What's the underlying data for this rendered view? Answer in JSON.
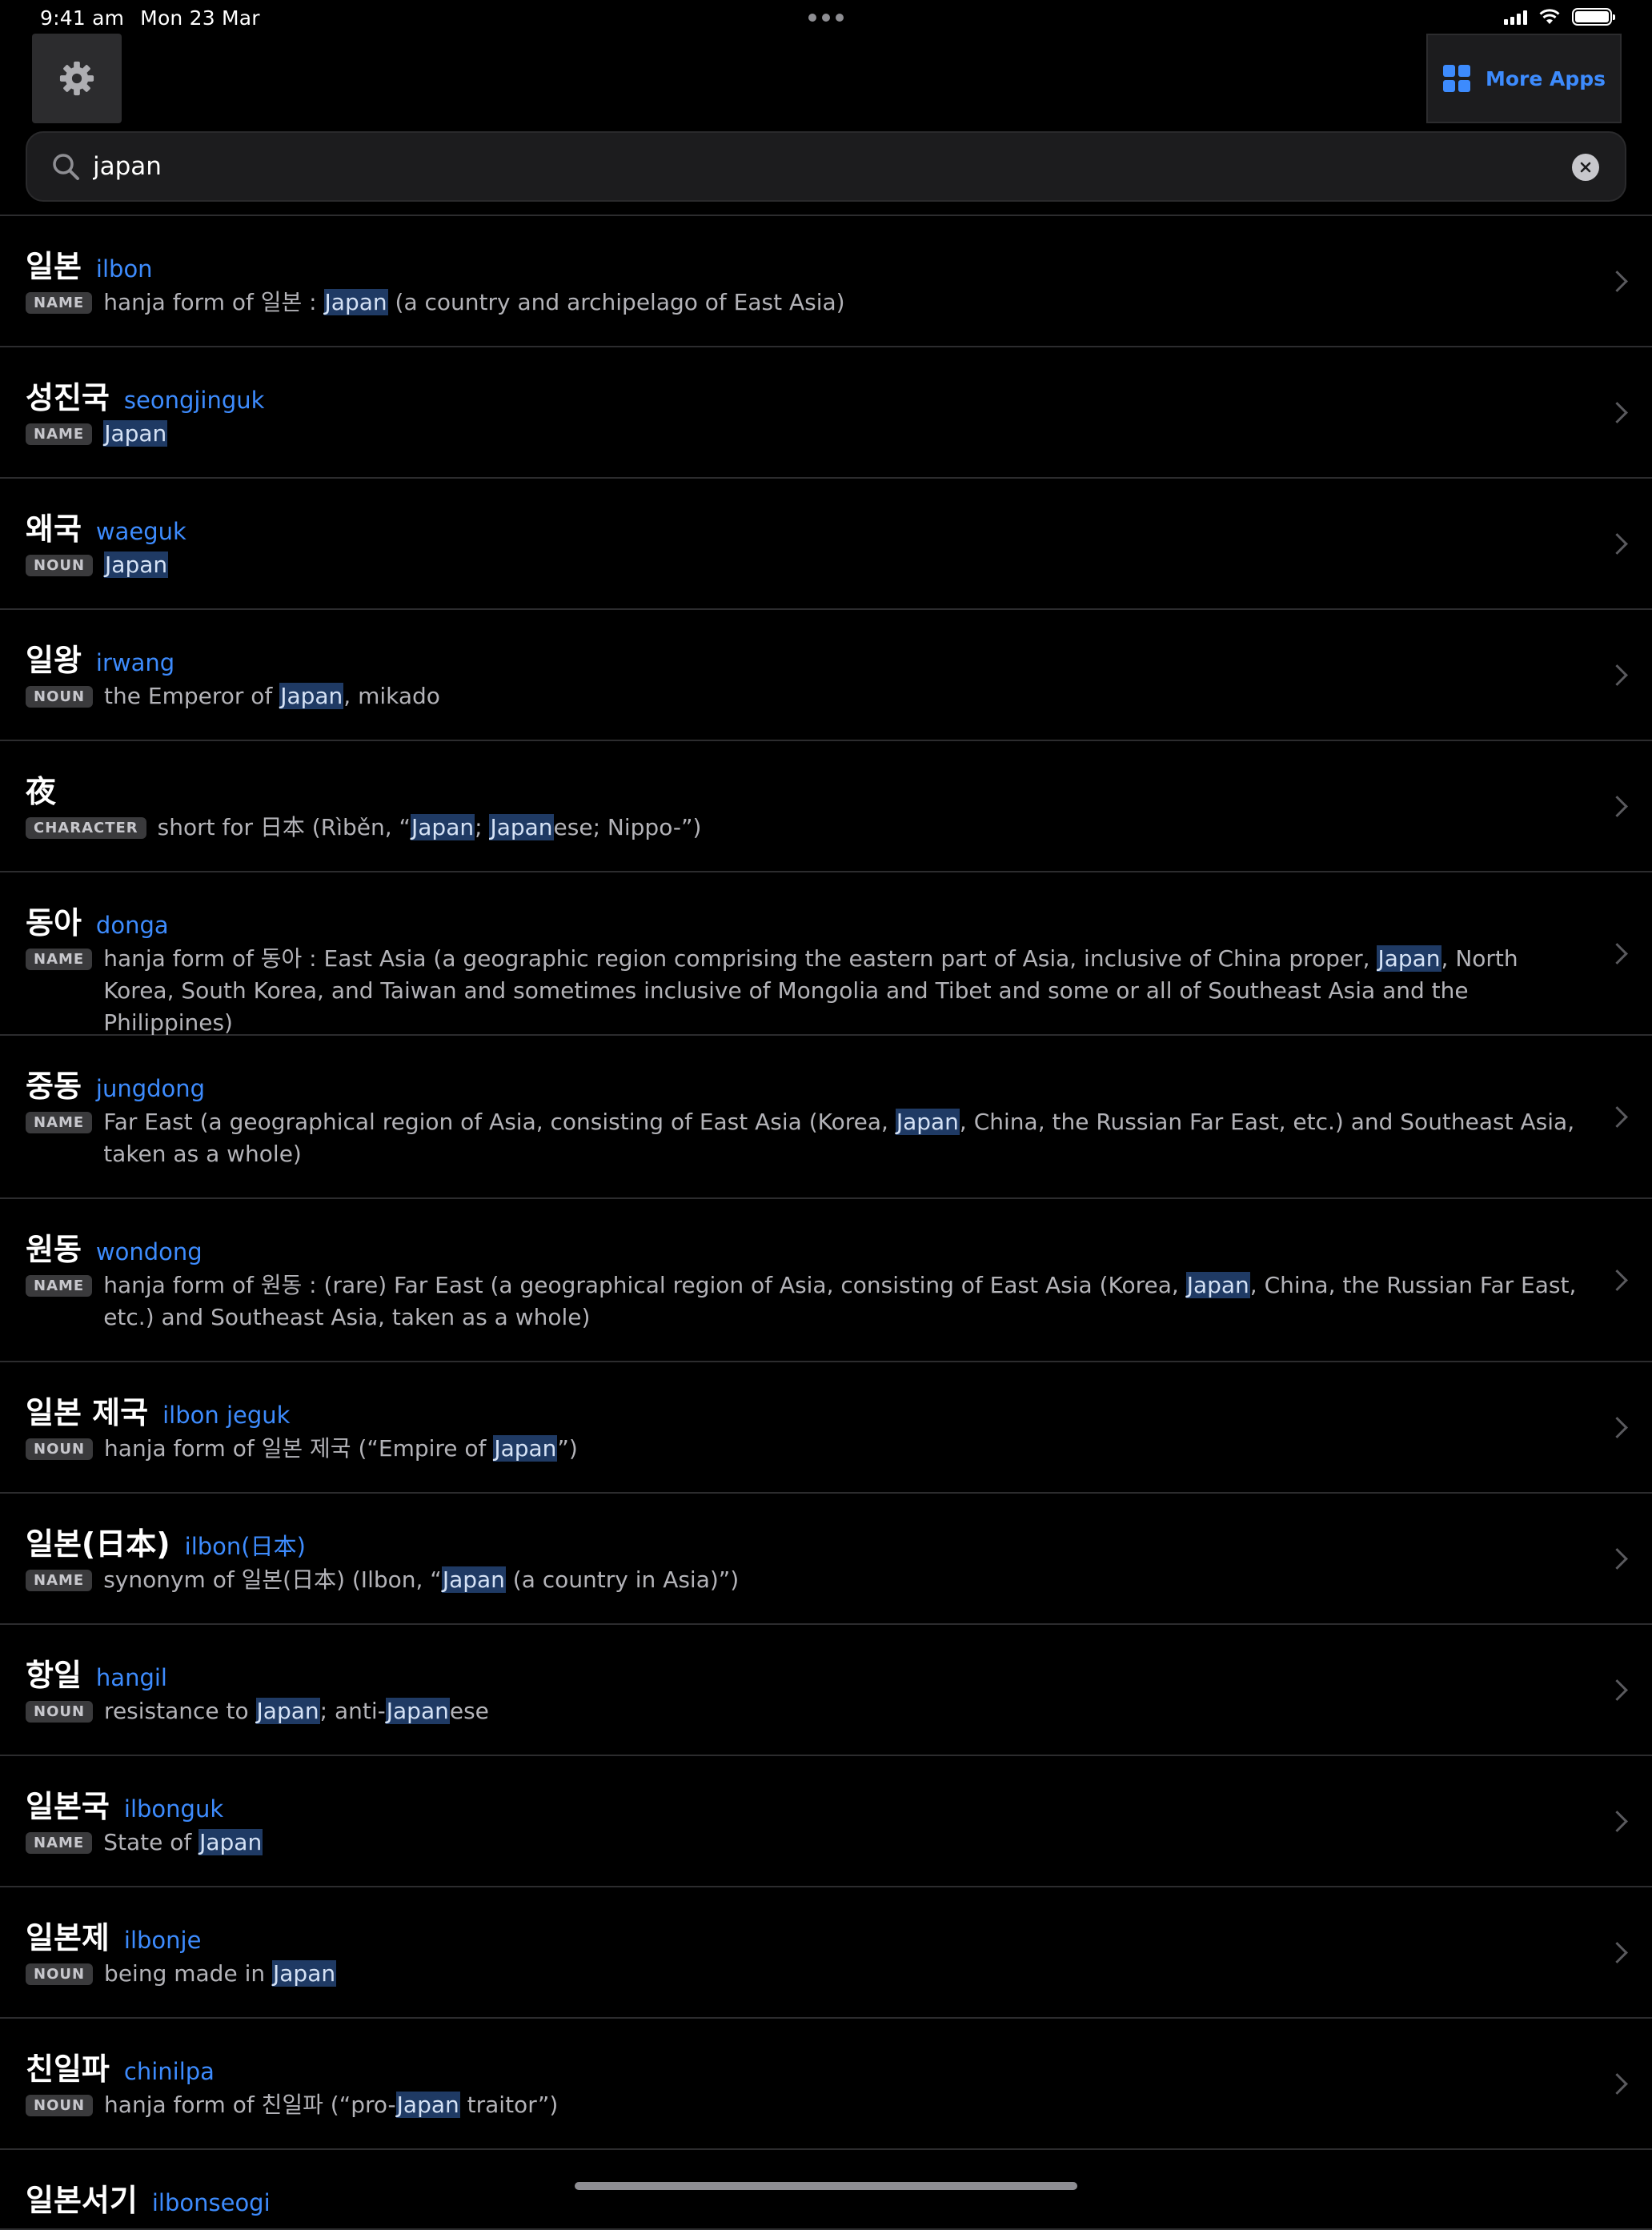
{
  "status": {
    "time": "9:41 am",
    "date": "Mon 23 Mar"
  },
  "toolbar": {
    "more_apps_label": "More Apps",
    "settings_icon": "gear-icon",
    "more_apps_icon": "grid-icon"
  },
  "search": {
    "value": "japan",
    "placeholder": ""
  },
  "colors": {
    "accent": "#3d8bfd",
    "highlight": "#1f3a64",
    "background": "#000000"
  },
  "results": [
    {
      "headword": "일본",
      "romanization": "ilbon",
      "pos": "NAME",
      "definition": [
        {
          "t": "hanja form of 일본 : "
        },
        {
          "t": "Japan",
          "hl": true
        },
        {
          "t": " (a country and archipelago of East Asia)"
        }
      ]
    },
    {
      "headword": "성진국",
      "romanization": "seongjinguk",
      "pos": "NAME",
      "definition": [
        {
          "t": "Japan",
          "hl": true
        }
      ]
    },
    {
      "headword": "왜국",
      "romanization": "waeguk",
      "pos": "NOUN",
      "definition": [
        {
          "t": "Japan",
          "hl": true
        }
      ]
    },
    {
      "headword": "일왕",
      "romanization": "irwang",
      "pos": "NOUN",
      "definition": [
        {
          "t": "the Emperor of "
        },
        {
          "t": "Japan",
          "hl": true
        },
        {
          "t": ", mikado"
        }
      ]
    },
    {
      "headword": "夜",
      "romanization": "",
      "pos": "CHARACTER",
      "definition": [
        {
          "t": "short for 日本 (Rìběn, “"
        },
        {
          "t": "Japan",
          "hl": true
        },
        {
          "t": "; "
        },
        {
          "t": "Japan",
          "hl": true
        },
        {
          "t": "ese; Nippo-”)"
        }
      ]
    },
    {
      "headword": "동아",
      "romanization": "donga",
      "pos": "NAME",
      "definition": [
        {
          "t": "hanja form of 동아 : East Asia (a geographic region comprising the eastern part of Asia, inclusive of China proper, "
        },
        {
          "t": "Japan",
          "hl": true
        },
        {
          "t": ", North Korea, South Korea, and Taiwan and sometimes inclusive of Mongolia and Tibet and some or all of Southeast Asia and the Philippines)"
        }
      ]
    },
    {
      "headword": "중동",
      "romanization": "jungdong",
      "pos": "NAME",
      "definition": [
        {
          "t": "Far East (a geographical region of Asia, consisting of East Asia (Korea, "
        },
        {
          "t": "Japan",
          "hl": true
        },
        {
          "t": ", China, the Russian Far East, etc.) and Southeast Asia, taken as a whole)"
        }
      ]
    },
    {
      "headword": "원동",
      "romanization": "wondong",
      "pos": "NAME",
      "definition": [
        {
          "t": "hanja form of 원동 : (rare) Far East (a geographical region of Asia, consisting of East Asia (Korea, "
        },
        {
          "t": "Japan",
          "hl": true
        },
        {
          "t": ", China, the Russian Far East, etc.) and Southeast Asia, taken as a whole)"
        }
      ]
    },
    {
      "headword": "일본 제국",
      "romanization": "ilbon jeguk",
      "pos": "NOUN",
      "definition": [
        {
          "t": "hanja form of 일본 제국 (“Empire of "
        },
        {
          "t": "Japan",
          "hl": true
        },
        {
          "t": "”)"
        }
      ]
    },
    {
      "headword": "일본(日本)",
      "romanization": "ilbon(日本)",
      "pos": "NAME",
      "definition": [
        {
          "t": "synonym of 일본(日本) (Ilbon, “"
        },
        {
          "t": "Japan",
          "hl": true
        },
        {
          "t": " (a country in Asia)”)"
        }
      ]
    },
    {
      "headword": "항일",
      "romanization": "hangil",
      "pos": "NOUN",
      "definition": [
        {
          "t": "resistance to "
        },
        {
          "t": "Japan",
          "hl": true
        },
        {
          "t": "; anti-"
        },
        {
          "t": "Japan",
          "hl": true
        },
        {
          "t": "ese"
        }
      ]
    },
    {
      "headword": "일본국",
      "romanization": "ilbonguk",
      "pos": "NAME",
      "definition": [
        {
          "t": "State of "
        },
        {
          "t": "Japan",
          "hl": true
        }
      ]
    },
    {
      "headword": "일본제",
      "romanization": "ilbonje",
      "pos": "NOUN",
      "definition": [
        {
          "t": "being made in "
        },
        {
          "t": "Japan",
          "hl": true
        }
      ]
    },
    {
      "headword": "친일파",
      "romanization": "chinilpa",
      "pos": "NOUN",
      "definition": [
        {
          "t": "hanja form of 친일파 (“pro-"
        },
        {
          "t": "Japan",
          "hl": true
        },
        {
          "t": " traitor”)"
        }
      ]
    },
    {
      "headword": "일본서기",
      "romanization": "ilbonseogi",
      "pos": "",
      "definition": []
    }
  ]
}
